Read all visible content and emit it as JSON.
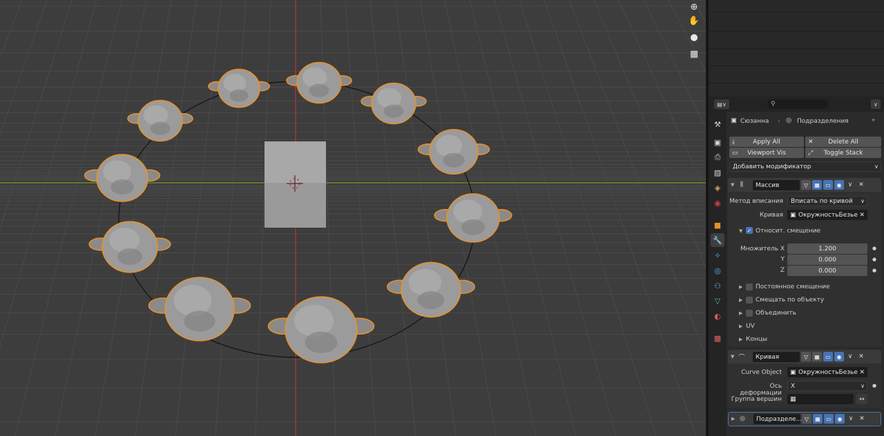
{
  "viewport": {
    "nav_icons": [
      "zoom-icon",
      "pan-hand-icon",
      "camera-icon",
      "grid-icon"
    ]
  },
  "props_header": {
    "search_placeholder": ""
  },
  "breadcrumb": {
    "object": "Сюзанна",
    "modifier": "Подразделения"
  },
  "toolbar": {
    "apply_all": "Apply All",
    "delete_all": "Delete All",
    "viewport_vis": "Viewport Vis",
    "toggle_stack": "Toggle Stack",
    "add_modifier": "Добавить модификатор"
  },
  "array_mod": {
    "name": "Массив",
    "fit_method_label": "Метод вписания",
    "fit_method_value": "Вписать по кривой",
    "curve_label": "Кривая",
    "curve_value": "ОкружностьБезье",
    "relative_offset_label": "Относит. смещение",
    "multiplier_label": "Множитель X",
    "y_label": "Y",
    "z_label": "Z",
    "x_value": "1.200",
    "y_value": "0.000",
    "z_value": "0.000",
    "const_offset": "Постоянное смещение",
    "object_offset": "Смещать по объекту",
    "merge": "Объединить",
    "uv": "UV",
    "caps": "Концы"
  },
  "curve_mod": {
    "name": "Кривая",
    "curve_object_label": "Curve Object",
    "curve_object_value": "ОкружностьБезье",
    "deform_axis_label": "Ось деформации",
    "deform_axis_value": "X",
    "vertex_group_label": "Группа вершин"
  },
  "subsurf_mod": {
    "name": "Подразделе..."
  },
  "colors": {
    "accent": "#4772b3",
    "selection_outline": "#e8902a",
    "x_axis": "#b53a3a",
    "y_axis": "#6f9a2d"
  }
}
